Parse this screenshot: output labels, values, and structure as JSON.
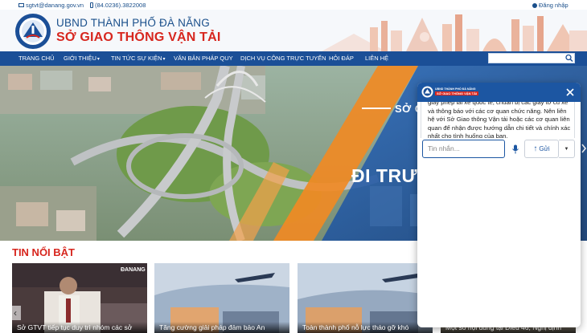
{
  "topbar": {
    "email": "sgtvt@danang.gov.vn",
    "phone": "(84.0236).3822008",
    "login": "Đăng nhập"
  },
  "header": {
    "org_line1": "UBND THÀNH PHỐ ĐÀ NẴNG",
    "org_line2": "SỞ GIAO THÔNG VẬN TẢI"
  },
  "nav": {
    "items": [
      {
        "label": "TRANG CHỦ"
      },
      {
        "label": "GIỚI THIỆU",
        "dropdown": true
      },
      {
        "label": "TIN TỨC SỰ KIỆN",
        "dropdown": true
      },
      {
        "label": "VĂN BẢN PHÁP QUY"
      },
      {
        "label": "DỊCH VỤ CÔNG TRỰC TUYẾN"
      },
      {
        "label": "HỎI ĐÁP"
      },
      {
        "label": "LIÊN HỆ"
      }
    ],
    "search_placeholder": ""
  },
  "hero": {
    "text1": "SỞ G",
    "text2": "ĐI TRƯ"
  },
  "news": {
    "title": "TIN NỔI BẬT",
    "cards": [
      {
        "caption": "Sở GTVT tiếp tục duy trì nhóm các sở",
        "tag": "ĐANANG"
      },
      {
        "caption": "Tăng cường giải pháp đảm bảo An"
      },
      {
        "caption": "Toàn thành phố nỗ lực tháo gỡ khó"
      },
      {
        "caption": "Một số nội dung tại Điều 46, Nghị định"
      }
    ]
  },
  "chat": {
    "title_line1": "UBND THÀNH PHỐ ĐÀ NẴNG",
    "title_line2": "SỞ GIAO THÔNG VẬN TẢI",
    "message": "giấy phép lái xe quốc tế, chuẩn bị các giấy tờ cũ xe và thông báo với các cơ quan chức năng. Nên liên hệ với Sở Giao thông Vận tải hoặc các cơ quan liên quan để nhận được hướng dẫn chi tiết và chính xác nhất cho tình huống của bạn.",
    "input_placeholder": "Tin nhắn...",
    "send_label": "Gửi"
  },
  "colors": {
    "nav_bg": "#1b4f97",
    "brand_red": "#d7261e",
    "brand_blue": "#1a4f8b",
    "chat_header": "#1c56a2"
  }
}
